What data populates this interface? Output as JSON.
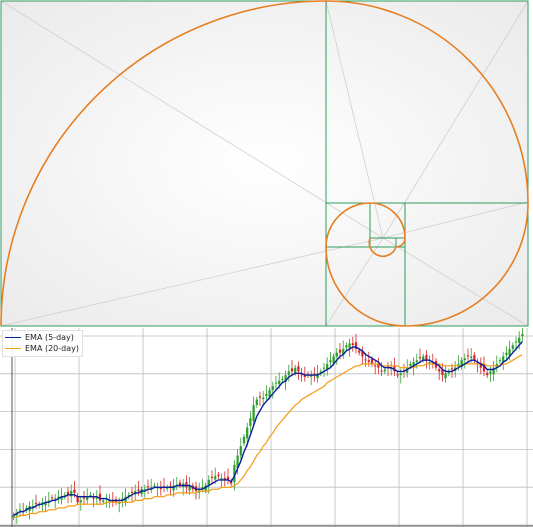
{
  "colors": {
    "golden_box": "#2e9e5b",
    "spiral": "#e67e22",
    "bull": "#2ca02c",
    "bear": "#d62728",
    "ema_short": "#0a1f9e",
    "ema_long": "#f39c12",
    "grid": "#bdbdbd"
  },
  "legend": [
    {
      "label": "EMA (5-day)",
      "color": "#0a1f9e"
    },
    {
      "label": "EMA (20-day)",
      "color": "#f39c12"
    }
  ],
  "chart_data": [
    {
      "type": "diagram",
      "ratio": 1.618,
      "levels": 8,
      "gradient_background": true
    },
    {
      "type": "candlestick",
      "grid": true,
      "ylim": [
        0,
        100
      ],
      "n_candles": 160,
      "close": [
        3,
        4,
        6,
        5,
        7,
        8,
        8,
        9,
        9,
        10,
        10,
        11,
        12,
        12,
        13,
        13,
        14,
        14,
        16,
        15,
        10,
        11,
        12,
        13,
        14,
        12,
        13,
        11,
        11,
        12,
        11,
        10,
        10,
        10,
        12,
        13,
        14,
        15,
        16,
        16,
        17,
        17,
        18,
        18,
        19,
        18,
        17,
        18,
        18,
        18,
        19,
        19,
        19,
        20,
        18,
        19,
        17,
        16,
        17,
        18,
        19,
        22,
        23,
        24,
        24,
        23,
        22,
        22,
        20,
        30,
        35,
        40,
        45,
        50,
        55,
        62,
        65,
        66,
        66,
        68,
        70,
        72,
        74,
        75,
        76,
        78,
        80,
        80,
        82,
        80,
        78,
        77,
        78,
        78,
        78,
        79,
        80,
        82,
        84,
        86,
        88,
        90,
        90,
        92,
        94,
        95,
        94,
        92,
        90,
        88,
        86,
        85,
        84,
        83,
        82,
        80,
        81,
        82,
        82,
        80,
        78,
        79,
        80,
        82,
        84,
        85,
        86,
        87,
        88,
        86,
        85,
        84,
        82,
        80,
        78,
        79,
        80,
        81,
        82,
        84,
        86,
        87,
        88,
        88,
        86,
        84,
        82,
        80,
        78,
        80,
        82,
        84,
        86,
        88,
        90,
        92,
        94,
        96,
        98,
        100
      ],
      "ema5": [
        3,
        4,
        5,
        5,
        6,
        7,
        7,
        8,
        9,
        9,
        10,
        10,
        11,
        11,
        12,
        13,
        13,
        14,
        14,
        14,
        13,
        13,
        13,
        13,
        13,
        13,
        13,
        12,
        12,
        12,
        11,
        11,
        11,
        11,
        11,
        12,
        13,
        14,
        15,
        15,
        16,
        16,
        17,
        17,
        18,
        18,
        18,
        18,
        18,
        18,
        18,
        19,
        19,
        19,
        19,
        19,
        18,
        17,
        17,
        17,
        18,
        19,
        20,
        21,
        22,
        22,
        22,
        22,
        21,
        24,
        28,
        32,
        37,
        41,
        46,
        51,
        56,
        59,
        62,
        64,
        66,
        68,
        70,
        72,
        74,
        75,
        77,
        78,
        79,
        79,
        79,
        78,
        78,
        78,
        78,
        78,
        79,
        80,
        81,
        82,
        84,
        86,
        88,
        89,
        91,
        92,
        93,
        93,
        92,
        91,
        89,
        88,
        87,
        86,
        85,
        83,
        82,
        82,
        82,
        81,
        80,
        80,
        80,
        81,
        82,
        83,
        84,
        85,
        86,
        86,
        86,
        85,
        84,
        83,
        81,
        80,
        80,
        80,
        81,
        82,
        83,
        84,
        85,
        86,
        86,
        85,
        84,
        83,
        81,
        81,
        81,
        82,
        83,
        85,
        86,
        88,
        90,
        92,
        94,
        96
      ],
      "ema20": [
        2,
        2,
        3,
        3,
        3,
        4,
        4,
        4,
        5,
        5,
        5,
        6,
        6,
        6,
        7,
        7,
        7,
        8,
        8,
        8,
        9,
        9,
        9,
        9,
        9,
        9,
        9,
        9,
        9,
        10,
        10,
        10,
        10,
        10,
        10,
        10,
        10,
        10,
        11,
        11,
        11,
        12,
        12,
        12,
        13,
        13,
        13,
        13,
        14,
        14,
        14,
        15,
        15,
        15,
        15,
        15,
        15,
        15,
        16,
        16,
        16,
        16,
        17,
        17,
        17,
        18,
        18,
        18,
        18,
        19,
        20,
        22,
        24,
        27,
        29,
        32,
        35,
        37,
        40,
        42,
        45,
        47,
        50,
        52,
        54,
        56,
        58,
        60,
        62,
        63,
        65,
        66,
        67,
        68,
        69,
        70,
        71,
        72,
        74,
        75,
        76,
        77,
        78,
        79,
        80,
        81,
        82,
        83,
        83,
        84,
        84,
        84,
        84,
        84,
        84,
        83,
        83,
        83,
        83,
        83,
        83,
        82,
        82,
        82,
        82,
        82,
        83,
        83,
        83,
        84,
        84,
        84,
        84,
        84,
        83,
        83,
        83,
        83,
        83,
        83,
        83,
        84,
        84,
        84,
        84,
        84,
        84,
        84,
        83,
        83,
        83,
        83,
        83,
        84,
        84,
        85,
        86,
        87,
        88,
        89
      ]
    }
  ]
}
